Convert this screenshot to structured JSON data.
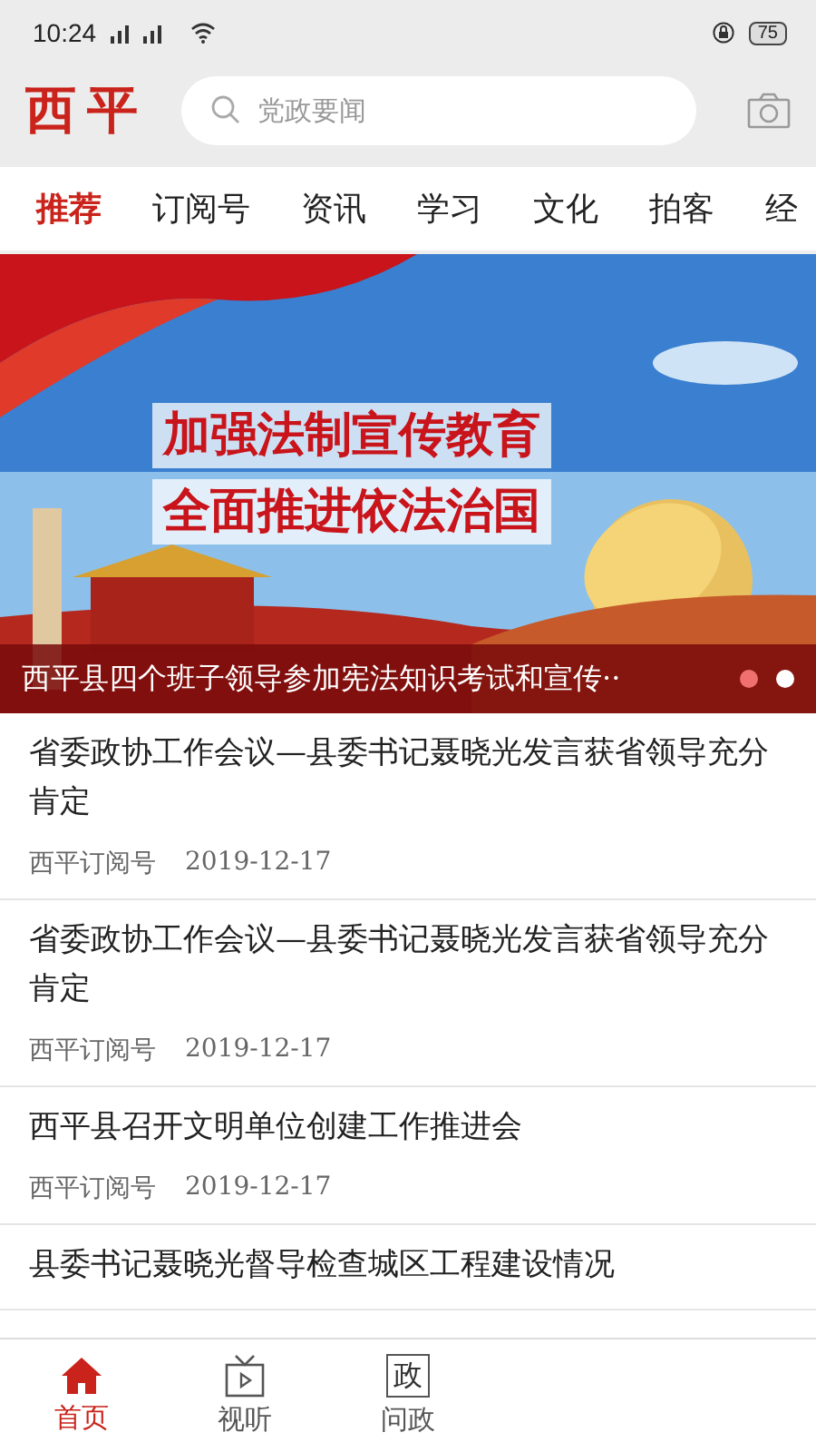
{
  "status_bar": {
    "time": "10:24",
    "battery": "75"
  },
  "header": {
    "logo": "西平",
    "search": {
      "placeholder": "党政要闻"
    }
  },
  "tabs": [
    {
      "label": "推荐",
      "selected": true
    },
    {
      "label": "订阅号",
      "selected": false
    },
    {
      "label": "资讯",
      "selected": false
    },
    {
      "label": "学习",
      "selected": false
    },
    {
      "label": "文化",
      "selected": false
    },
    {
      "label": "拍客",
      "selected": false
    },
    {
      "label": "经",
      "selected": false
    }
  ],
  "banner": {
    "kind": "picture",
    "slogans": [
      "加强法制宣传教育",
      "全面推进依法治国"
    ],
    "caption": "西平县四个班子领导参加宪法知识考试和宣传··",
    "dots": [
      {
        "selected": true
      },
      {
        "selected": false
      }
    ]
  },
  "articles": [
    {
      "title": "省委政协工作会议—县委书记聂晓光发言获省领导充分肯定",
      "source": "西平订阅号",
      "date": "2019-12-17"
    },
    {
      "title": "省委政协工作会议—县委书记聂晓光发言获省领导充分肯定",
      "source": "西平订阅号",
      "date": "2019-12-17"
    },
    {
      "title": "西平县召开文明单位创建工作推进会",
      "source": "西平订阅号",
      "date": "2019-12-17"
    },
    {
      "title": "县委书记聂晓光督导检查城区工程建设情况"
    }
  ],
  "bottom_nav": [
    {
      "kind": "home",
      "label": "首页",
      "selected": true
    },
    {
      "kind": "tv",
      "label": "视听",
      "selected": false
    },
    {
      "kind": "char",
      "icon": "政",
      "label": "问政",
      "selected": false
    }
  ]
}
